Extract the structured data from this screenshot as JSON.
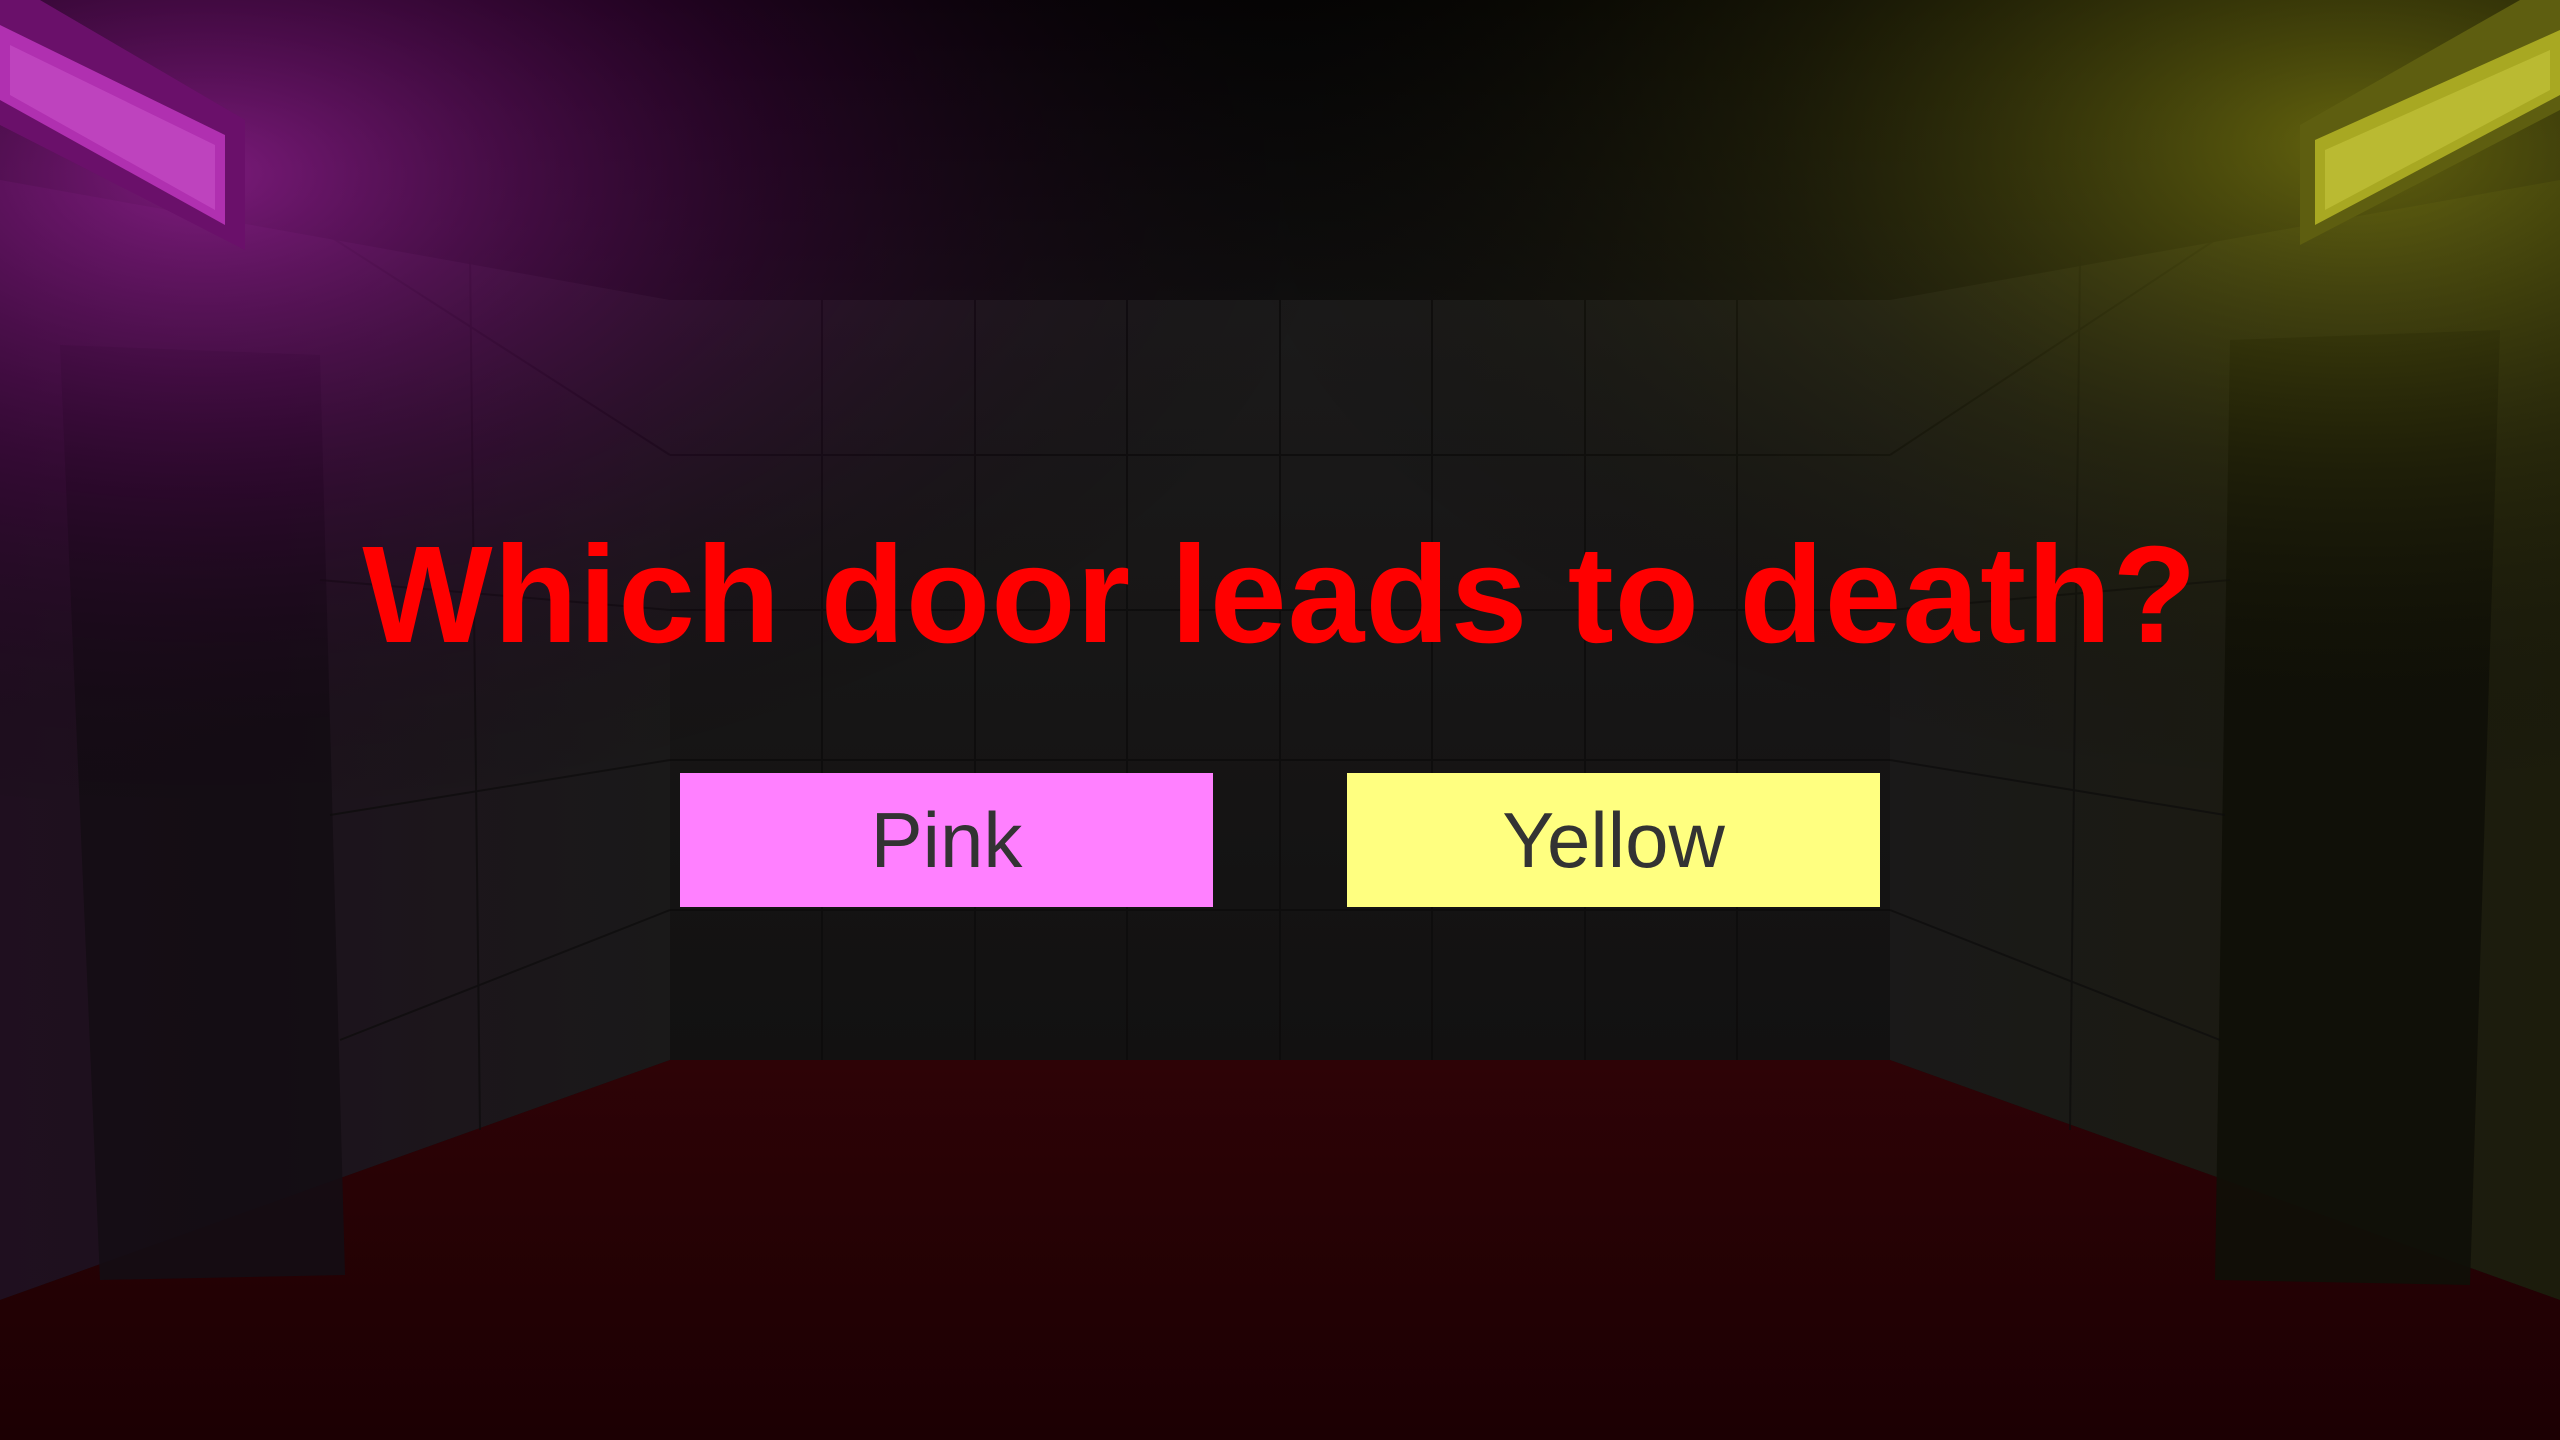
{
  "hud": {
    "question": "Which door leads to death?",
    "question_color": "#ff0000"
  },
  "choices": [
    {
      "label": "Pink",
      "color": "#ff80ff"
    },
    {
      "label": "Yellow",
      "color": "#ffff80"
    }
  ],
  "scene": {
    "left_light_color": "#c020c0",
    "right_light_color": "#c0c020",
    "floor_color": "#2a0003",
    "wall_color": "#1a1a1a"
  }
}
